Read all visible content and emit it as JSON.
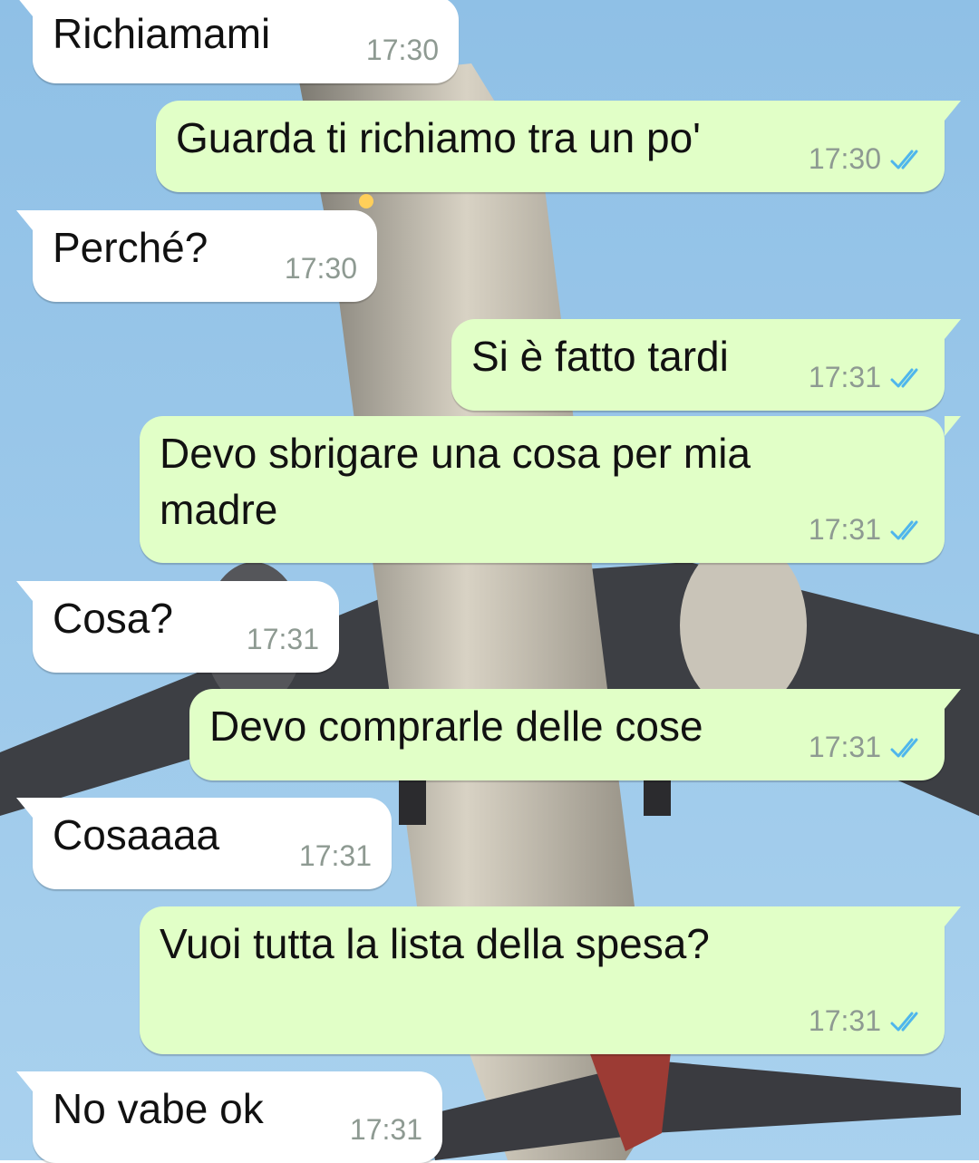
{
  "theme": {
    "sky_top": "#8fc0e6",
    "sky_bottom": "#a9d1ee",
    "incoming_bubble": "#ffffff",
    "outgoing_bubble": "#e1ffc7",
    "read_tick_color": "#4fb6ec"
  },
  "messages": [
    {
      "direction": "in",
      "text": "Richiamami",
      "time": "17:30"
    },
    {
      "direction": "out",
      "text": "Guarda ti richiamo tra un po'",
      "time": "17:30",
      "status": "read-ticks-icon"
    },
    {
      "direction": "in",
      "text": "Perché?",
      "time": "17:30"
    },
    {
      "direction": "out",
      "text": "Si è fatto tardi",
      "time": "17:31",
      "status": "read-ticks-icon"
    },
    {
      "direction": "out",
      "text": "Devo sbrigare una cosa per mia madre",
      "time": "17:31",
      "status": "read-ticks-icon"
    },
    {
      "direction": "in",
      "text": "Cosa?",
      "time": "17:31"
    },
    {
      "direction": "out",
      "text": "Devo comprarle delle cose",
      "time": "17:31",
      "status": "read-ticks-icon"
    },
    {
      "direction": "in",
      "text": "Cosaaaa",
      "time": "17:31"
    },
    {
      "direction": "out",
      "text": "Vuoi tutta la lista della spesa?",
      "time": "17:31",
      "status": "read-ticks-icon"
    },
    {
      "direction": "in",
      "text": "No vabe ok",
      "time": "17:31"
    }
  ]
}
